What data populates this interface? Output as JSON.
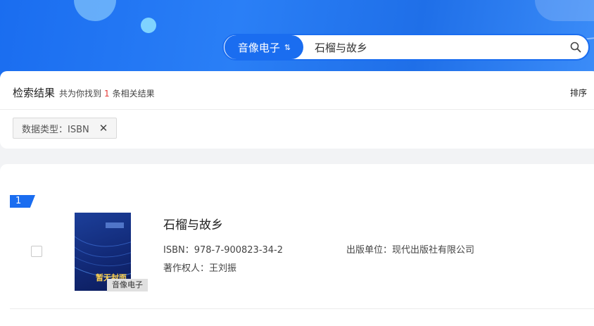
{
  "search": {
    "type_label": "音像电子",
    "swap_symbol": "⇅",
    "query": "石榴与故乡"
  },
  "results": {
    "title": "检索结果",
    "found_prefix": "共为你找到",
    "count": "1",
    "found_suffix": "条相关结果",
    "sort_label": "排序"
  },
  "filter": {
    "label": "数据类型：ISBN",
    "close_glyph": "✕"
  },
  "items": [
    {
      "rank": "1",
      "title": "石榴与故乡",
      "isbn": "ISBN：978-7-900823-34-2",
      "publisher": "出版单位：现代出版社有限公司",
      "copyright": "著作权人：王刘振",
      "badge": "音像电子",
      "cover_placeholder": "暂无封面"
    }
  ],
  "colors": {
    "accent": "#1a6df0",
    "count_red": "#e53935"
  },
  "icons": {
    "search": "search-icon",
    "close": "close-icon"
  }
}
